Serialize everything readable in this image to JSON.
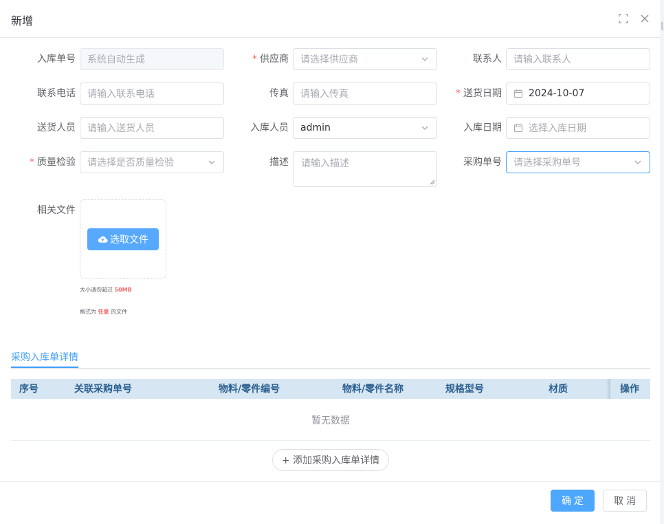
{
  "dialog": {
    "title": "新增",
    "fullscreen_icon": "fullscreen-icon",
    "close_icon": "close-icon"
  },
  "form": {
    "inbound_no": {
      "label": "入库单号",
      "placeholder": "系统自动生成"
    },
    "supplier": {
      "label": "供应商",
      "placeholder": "请选择供应商",
      "required": true
    },
    "contact": {
      "label": "联系人",
      "placeholder": "请输入联系人"
    },
    "phone": {
      "label": "联系电话",
      "placeholder": "请输入联系电话"
    },
    "fax": {
      "label": "传真",
      "placeholder": "请输入传真"
    },
    "delivery_date": {
      "label": "送货日期",
      "value": "2024-10-07",
      "required": true
    },
    "delivery_person": {
      "label": "送货人员",
      "placeholder": "请输入送货人员"
    },
    "inbound_person": {
      "label": "入库人员",
      "value": "admin"
    },
    "inbound_date": {
      "label": "入库日期",
      "placeholder": "选择入库日期"
    },
    "quality_check": {
      "label": "质量检验",
      "placeholder": "请选择是否质量检验",
      "required": true
    },
    "description": {
      "label": "描述",
      "placeholder": "请输入描述"
    },
    "purchase_no": {
      "label": "采购单号",
      "placeholder": "请选择采购单号"
    },
    "files": {
      "label": "相关文件",
      "button": "选取文件",
      "tip_size_prefix": "大小",
      "tip_size_mid": "请勿超过",
      "tip_size_value": "50MB",
      "tip_format_prefix": "格式为",
      "tip_format_value": "任意",
      "tip_format_suffix": "的文件"
    }
  },
  "tabs": {
    "active": "采购入库单详情"
  },
  "table": {
    "headers": [
      "序号",
      "关联采购单号",
      "物料/零件编号",
      "物料/零件名称",
      "规格型号",
      "材质",
      "操作"
    ],
    "empty_text": "暂无数据"
  },
  "add_detail_button": "+ 添加采购入库单详情",
  "footer": {
    "confirm": "确定",
    "cancel": "取消"
  },
  "colors": {
    "primary": "#409eff",
    "required": "#f56c6c",
    "header_bg": "#d7e6f3"
  }
}
